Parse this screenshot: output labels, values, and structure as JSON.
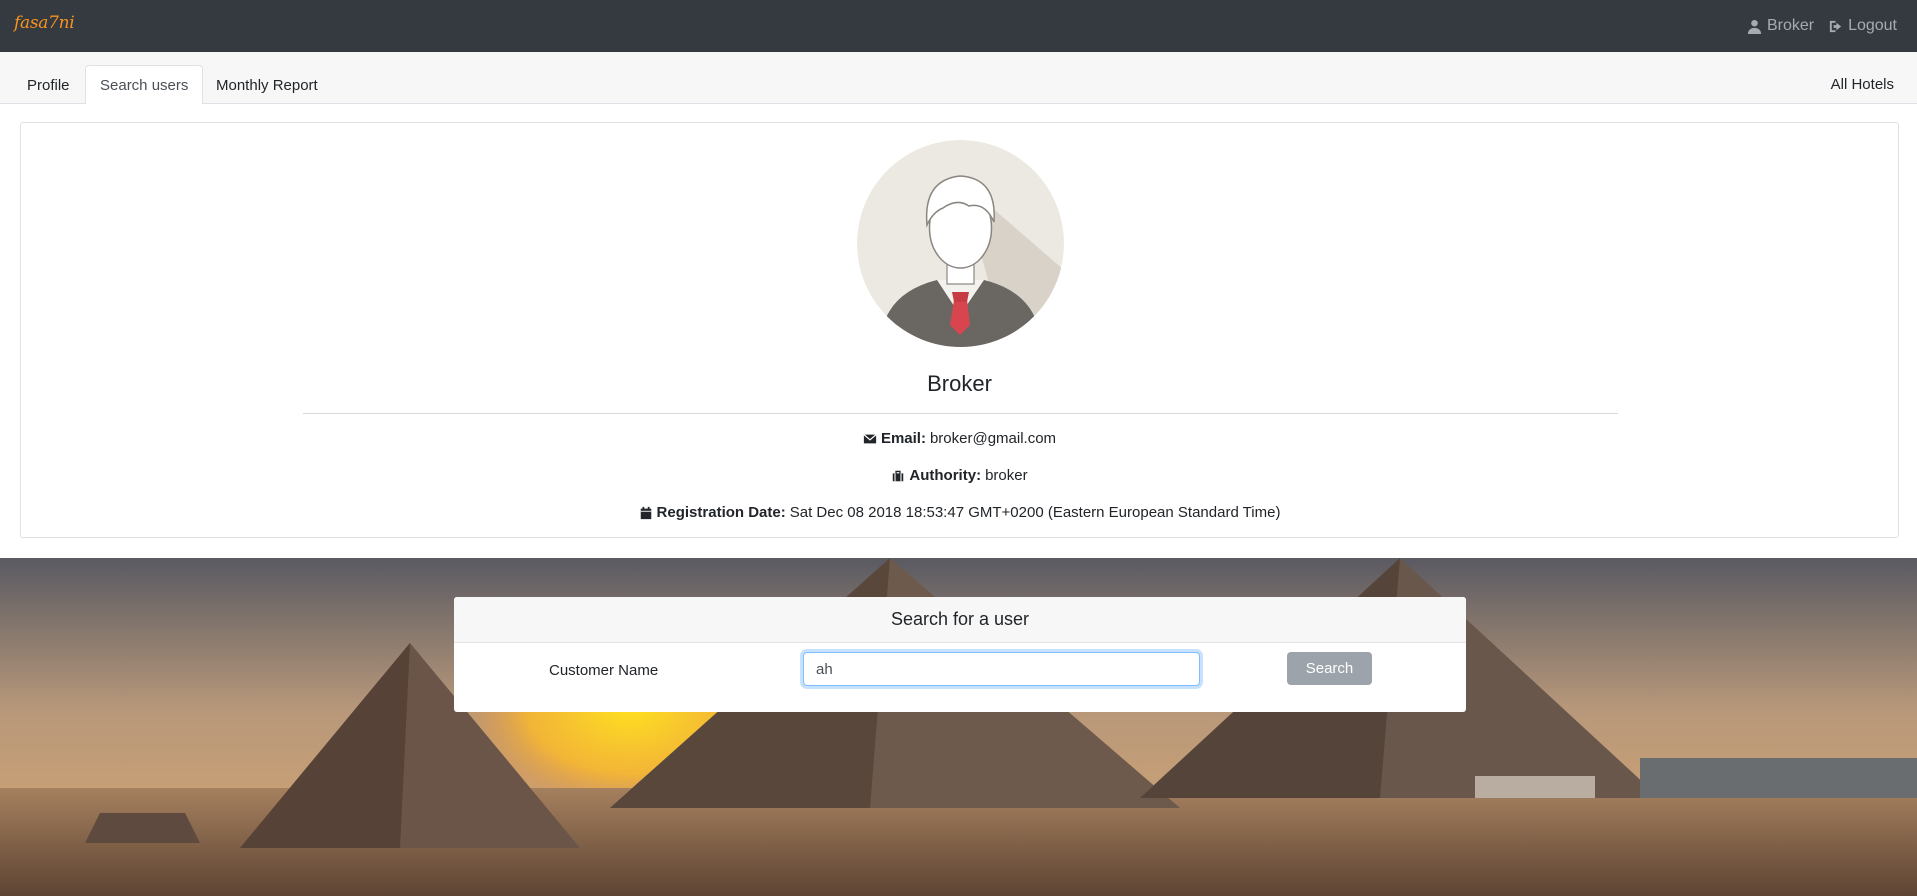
{
  "navbar": {
    "brand": "fasa7ni",
    "user_label": "Broker",
    "logout_label": "Logout",
    "brand_color": "#f7931e",
    "background": "#343a40"
  },
  "tabs": {
    "items": [
      {
        "label": "Profile",
        "active": false
      },
      {
        "label": "Search users",
        "active": true
      },
      {
        "label": "Monthly Report",
        "active": false
      }
    ],
    "right_label": "All Hotels"
  },
  "profile": {
    "name": "Broker",
    "email_label": "Email:",
    "email_value": "broker@gmail.com",
    "authority_label": "Authority:",
    "authority_value": "broker",
    "registration_label": "Registration Date:",
    "registration_value": "Sat Dec 08 2018 18:53:47 GMT+0200 (Eastern European Standard Time)"
  },
  "search": {
    "title": "Search for a user",
    "field_label": "Customer Name",
    "input_value": "ah",
    "button_label": "Search"
  },
  "icons": {
    "user": "user-icon",
    "logout": "sign-out-icon",
    "email": "envelope-icon",
    "authority": "briefcase-icon",
    "registration": "calendar-icon"
  }
}
